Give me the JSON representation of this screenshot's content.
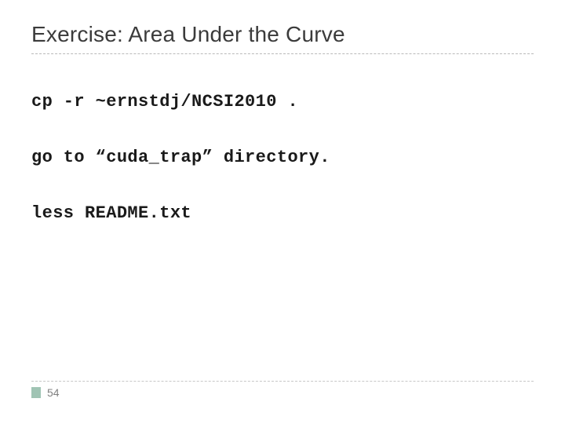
{
  "slide": {
    "title": "Exercise: Area Under the Curve",
    "lines": [
      "cp -r ~ernstdj/NCSI2010 .",
      "go to “cuda_trap” directory.",
      "less README.txt"
    ],
    "pageNumber": "54"
  }
}
